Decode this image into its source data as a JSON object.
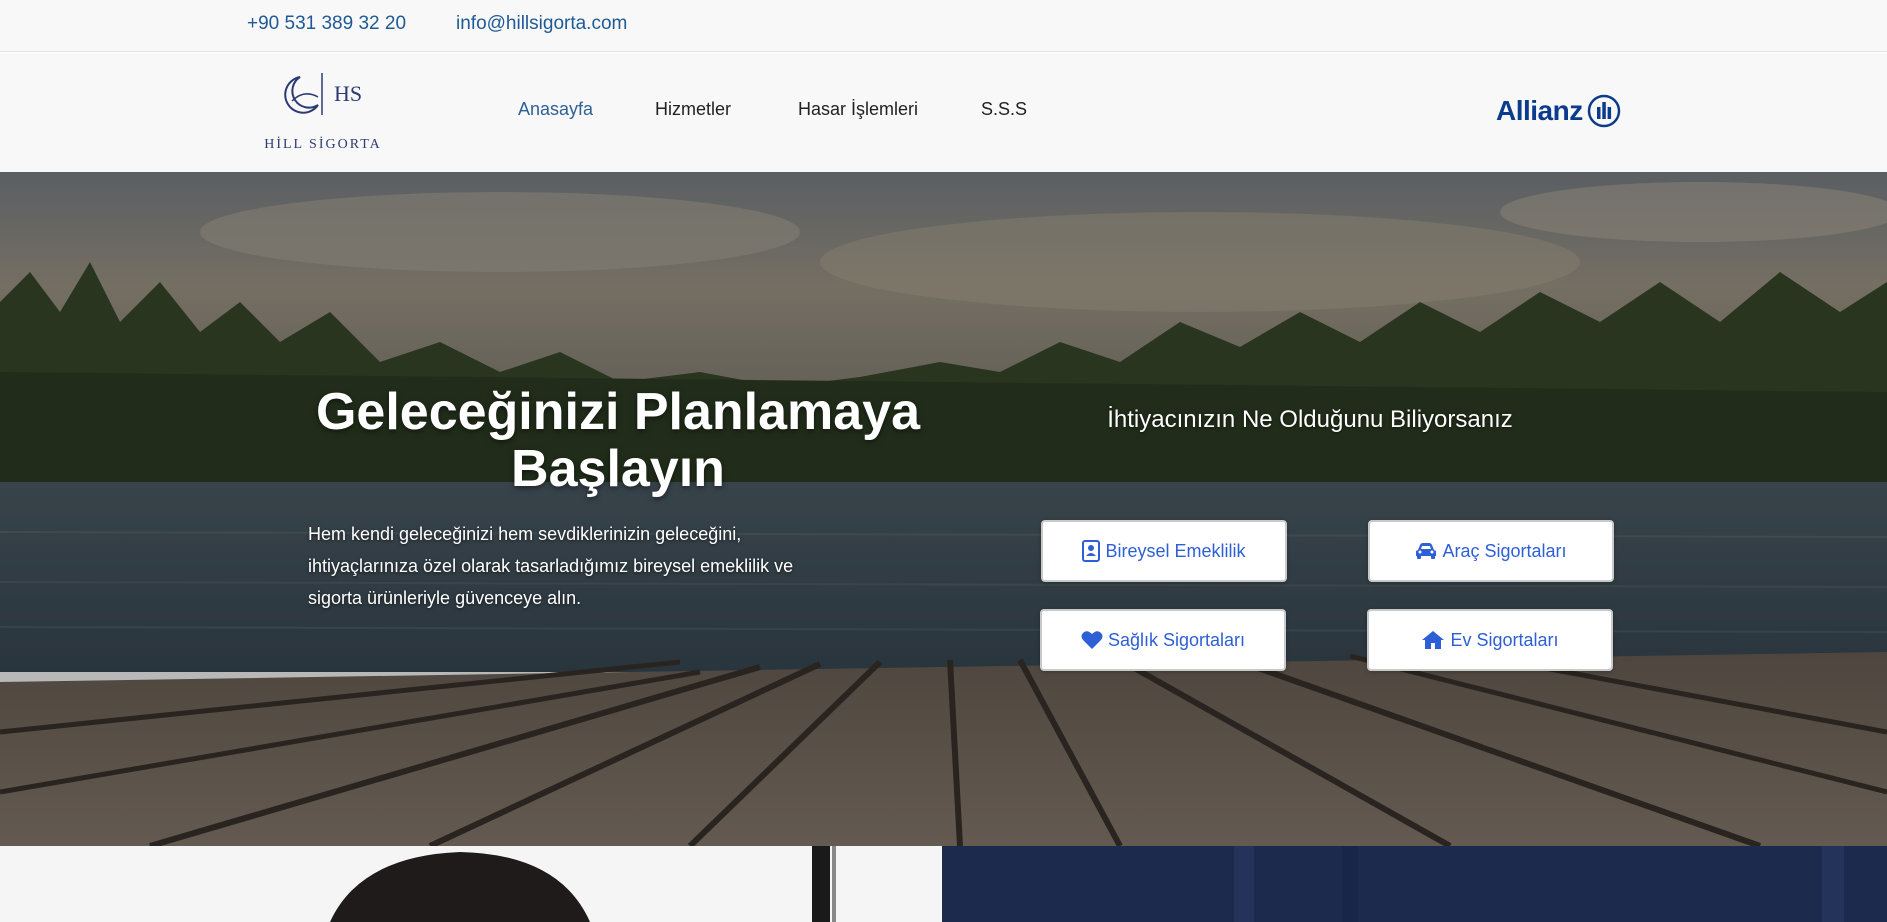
{
  "topbar": {
    "phone": "+90 531 389 32 20",
    "email": "info@hillsigorta.com"
  },
  "logo": {
    "monogram": "HS",
    "name": "HİLL SİGORTA"
  },
  "nav": {
    "items": [
      {
        "label": "Anasayfa",
        "active": true
      },
      {
        "label": "Hizmetler",
        "active": false
      },
      {
        "label": "Hasar İşlemleri",
        "active": false
      },
      {
        "label": "S.S.S",
        "active": false
      }
    ]
  },
  "partner": {
    "name": "Allianz",
    "icon": "allianz-emblem-icon",
    "color": "#0c3b8e"
  },
  "hero": {
    "title_line1": "Geleceğinizi Planlamaya",
    "title_line2": "Başlayın",
    "text": "Hem kendi geleceğinizi hem sevdiklerinizin geleceğini, ihtiyaçlarınıza özel olarak tasarladığımız bireysel emeklilik ve sigorta ürünleriyle güvenceye alın.",
    "question": "İhtiyacınızın Ne Olduğunu Biliyorsanız",
    "buttons": [
      {
        "label": "Bireysel Emeklilik",
        "icon": "contact-book-icon"
      },
      {
        "label": "Araç Sigortaları",
        "icon": "car-icon"
      },
      {
        "label": "Sağlık Sigortaları",
        "icon": "heart-icon"
      },
      {
        "label": "Ev Sigortaları",
        "icon": "home-icon"
      }
    ]
  },
  "colors": {
    "accent": "#2d5fd6",
    "link": "#1f5a96",
    "navy": "#1c2a4d"
  }
}
